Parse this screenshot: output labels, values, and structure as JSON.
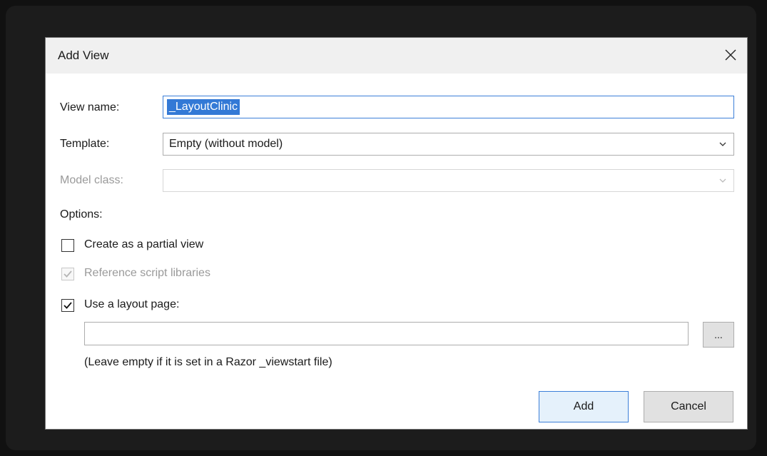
{
  "dialog": {
    "title": "Add View",
    "close_icon": "close-icon"
  },
  "form": {
    "view_name_label": "View name:",
    "view_name_value": "_LayoutClinic",
    "template_label": "Template:",
    "template_value": "Empty (without model)",
    "model_class_label": "Model class:",
    "model_class_value": "",
    "options_label": "Options:",
    "partial_view_label": "Create as a partial view",
    "partial_view_checked": false,
    "script_libraries_label": "Reference script libraries",
    "script_libraries_checked": true,
    "layout_page_label": "Use a layout page:",
    "layout_page_checked": true,
    "layout_path_value": "",
    "browse_label": "...",
    "layout_hint": "(Leave empty if it is set in a Razor _viewstart file)"
  },
  "buttons": {
    "add_label": "Add",
    "cancel_label": "Cancel"
  },
  "colors": {
    "accent": "#3379d6",
    "dialog_bg": "#ffffff",
    "titlebar_bg": "#f0f0f0",
    "backdrop": "#111111"
  }
}
